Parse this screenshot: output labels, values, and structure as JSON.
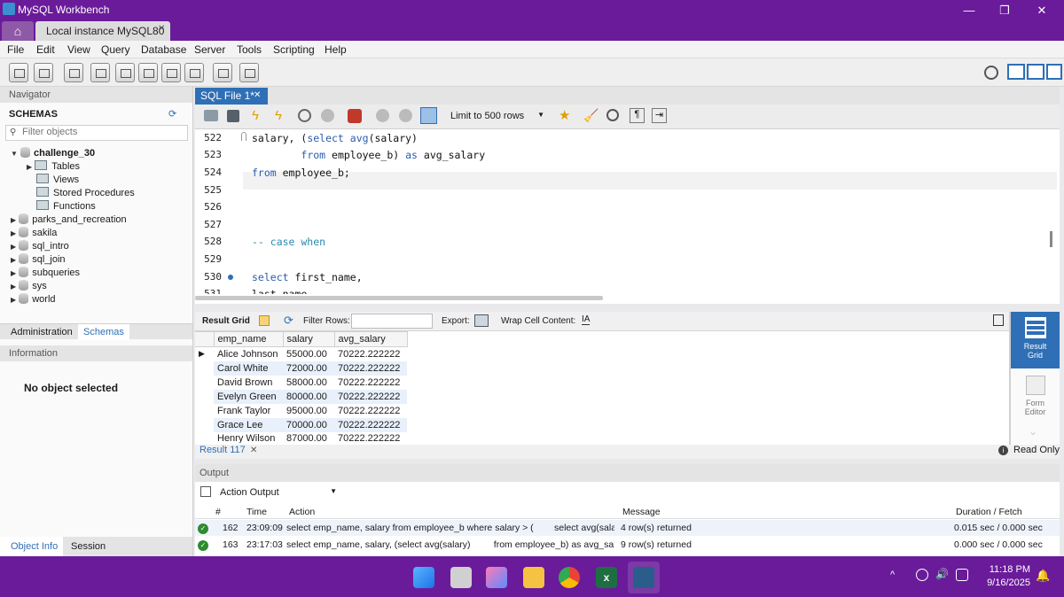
{
  "window": {
    "title": "MySQL Workbench",
    "connection_tab": "Local instance MySQL80",
    "minimize": "—",
    "maximize": "❐",
    "close": "✕"
  },
  "menu": [
    "File",
    "Edit",
    "View",
    "Query",
    "Database",
    "Server",
    "Tools",
    "Scripting",
    "Help"
  ],
  "navigator": {
    "header": "Navigator",
    "schemas_label": "SCHEMAS",
    "filter_placeholder": "Filter objects",
    "active_schema": "challenge_30",
    "children": [
      "Tables",
      "Views",
      "Stored Procedures",
      "Functions"
    ],
    "other_schemas": [
      "parks_and_recreation",
      "sakila",
      "sql_intro",
      "sql_join",
      "subqueries",
      "sys",
      "world"
    ],
    "tab_admin": "Administration",
    "tab_schemas": "Schemas",
    "info_header": "Information",
    "no_object": "No object selected",
    "tab_object_info": "Object Info",
    "tab_session": "Session"
  },
  "editor": {
    "tab": "SQL File 1*",
    "limit": "Limit to 500 rows",
    "lines": [
      {
        "n": "522",
        "code": "salary, (select avg(salary)"
      },
      {
        "n": "523",
        "code": "        from employee_b) as avg_salary"
      },
      {
        "n": "524",
        "code": "from employee_b;"
      },
      {
        "n": "525",
        "code": ""
      },
      {
        "n": "526",
        "code": ""
      },
      {
        "n": "527",
        "code": ""
      },
      {
        "n": "528",
        "code": "-- case when"
      },
      {
        "n": "529",
        "code": ""
      },
      {
        "n": "530",
        "code": "select first_name,"
      },
      {
        "n": "531",
        "code": "last_name"
      }
    ]
  },
  "results": {
    "result_grid": "Result Grid",
    "filter_rows": "Filter Rows:",
    "export": "Export:",
    "wrap": "Wrap Cell Content:",
    "columns": [
      "emp_name",
      "salary",
      "avg_salary"
    ],
    "rows": [
      [
        "Alice Johnson",
        "55000.00",
        "70222.222222"
      ],
      [
        "Carol White",
        "72000.00",
        "70222.222222"
      ],
      [
        "David Brown",
        "58000.00",
        "70222.222222"
      ],
      [
        "Evelyn Green",
        "80000.00",
        "70222.222222"
      ],
      [
        "Frank Taylor",
        "95000.00",
        "70222.222222"
      ],
      [
        "Grace Lee",
        "70000.00",
        "70222.222222"
      ],
      [
        "Henry Wilson",
        "87000.00",
        "70222.222222"
      ]
    ],
    "result_tab": "Result 117",
    "read_only": "Read Only",
    "side_result_grid": "Result Grid",
    "side_form_editor": "Form Editor"
  },
  "output": {
    "header": "Output",
    "selector": "Action Output",
    "columns": [
      "#",
      "Time",
      "Action",
      "Message",
      "Duration / Fetch"
    ],
    "rows": [
      {
        "n": "162",
        "time": "23:09:09",
        "action": "select emp_name, salary from employee_b where salary > (        select avg(salar...",
        "message": "4 row(s) returned",
        "duration": "0.015 sec / 0.000 sec"
      },
      {
        "n": "163",
        "time": "23:17:03",
        "action": "select emp_name, salary, (select avg(salary)         from employee_b) as avg_salar...",
        "message": "9 row(s) returned",
        "duration": "0.000 sec / 0.000 sec"
      }
    ]
  },
  "taskbar": {
    "time": "11:18 PM",
    "date": "9/16/2025"
  }
}
